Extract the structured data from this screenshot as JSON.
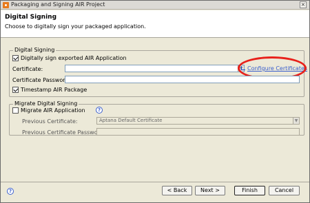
{
  "window": {
    "title": "Packaging and Signing AIR Project",
    "close_glyph": "×"
  },
  "header": {
    "title": "Digital Signing",
    "description": "Choose to digitally sign your packaged application."
  },
  "digital_signing": {
    "group_title": "Digital Signing",
    "sign_checkbox_label": "Digitally sign exported AIR Application",
    "sign_checked": true,
    "certificate_label": "Certificate:",
    "certificate_value": "",
    "dropdown_glyph": "▼",
    "configure_link": "Configure Certificates",
    "password_label": "Certificate Password:",
    "password_value": "",
    "timestamp_label": "Timestamp AIR Package",
    "timestamp_checked": true
  },
  "migrate_signing": {
    "group_title": "Migrate Digital Signing",
    "migrate_checkbox_label": "Migrate AIR Application",
    "migrate_checked": false,
    "help_glyph": "?",
    "previous_certificate_label": "Previous Certificate:",
    "previous_certificate_value": "Aptana Default Certificate",
    "dropdown_glyph": "▼",
    "previous_password_label": "Previous Certificate Password:",
    "previous_password_value": ""
  },
  "footer": {
    "help_glyph": "?",
    "back_label": "< Back",
    "next_label": "Next >",
    "finish_label": "Finish",
    "cancel_label": "Cancel"
  },
  "colors": {
    "annotation_ellipse": "#e8201a",
    "link": "#3a5fcd",
    "dialog_bg": "#ece9d8"
  }
}
